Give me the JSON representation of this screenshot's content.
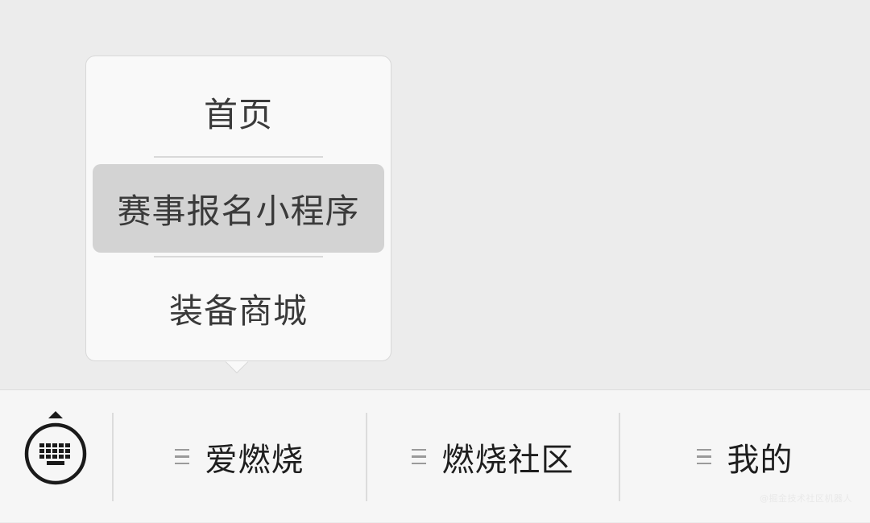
{
  "popup_menu": {
    "items": [
      {
        "label": "首页"
      },
      {
        "label": "赛事报名小程序",
        "selected": true
      },
      {
        "label": "装备商城"
      }
    ]
  },
  "bottom_bar": {
    "keyboard_toggle_icon": "keyboard-icon",
    "tabs": [
      {
        "label": "爱燃烧",
        "icon": "menu-lines-icon"
      },
      {
        "label": "燃烧社区",
        "icon": "menu-lines-icon"
      },
      {
        "label": "我的",
        "icon": "menu-lines-icon"
      }
    ]
  },
  "watermark": "@掘金技术社区机器人"
}
